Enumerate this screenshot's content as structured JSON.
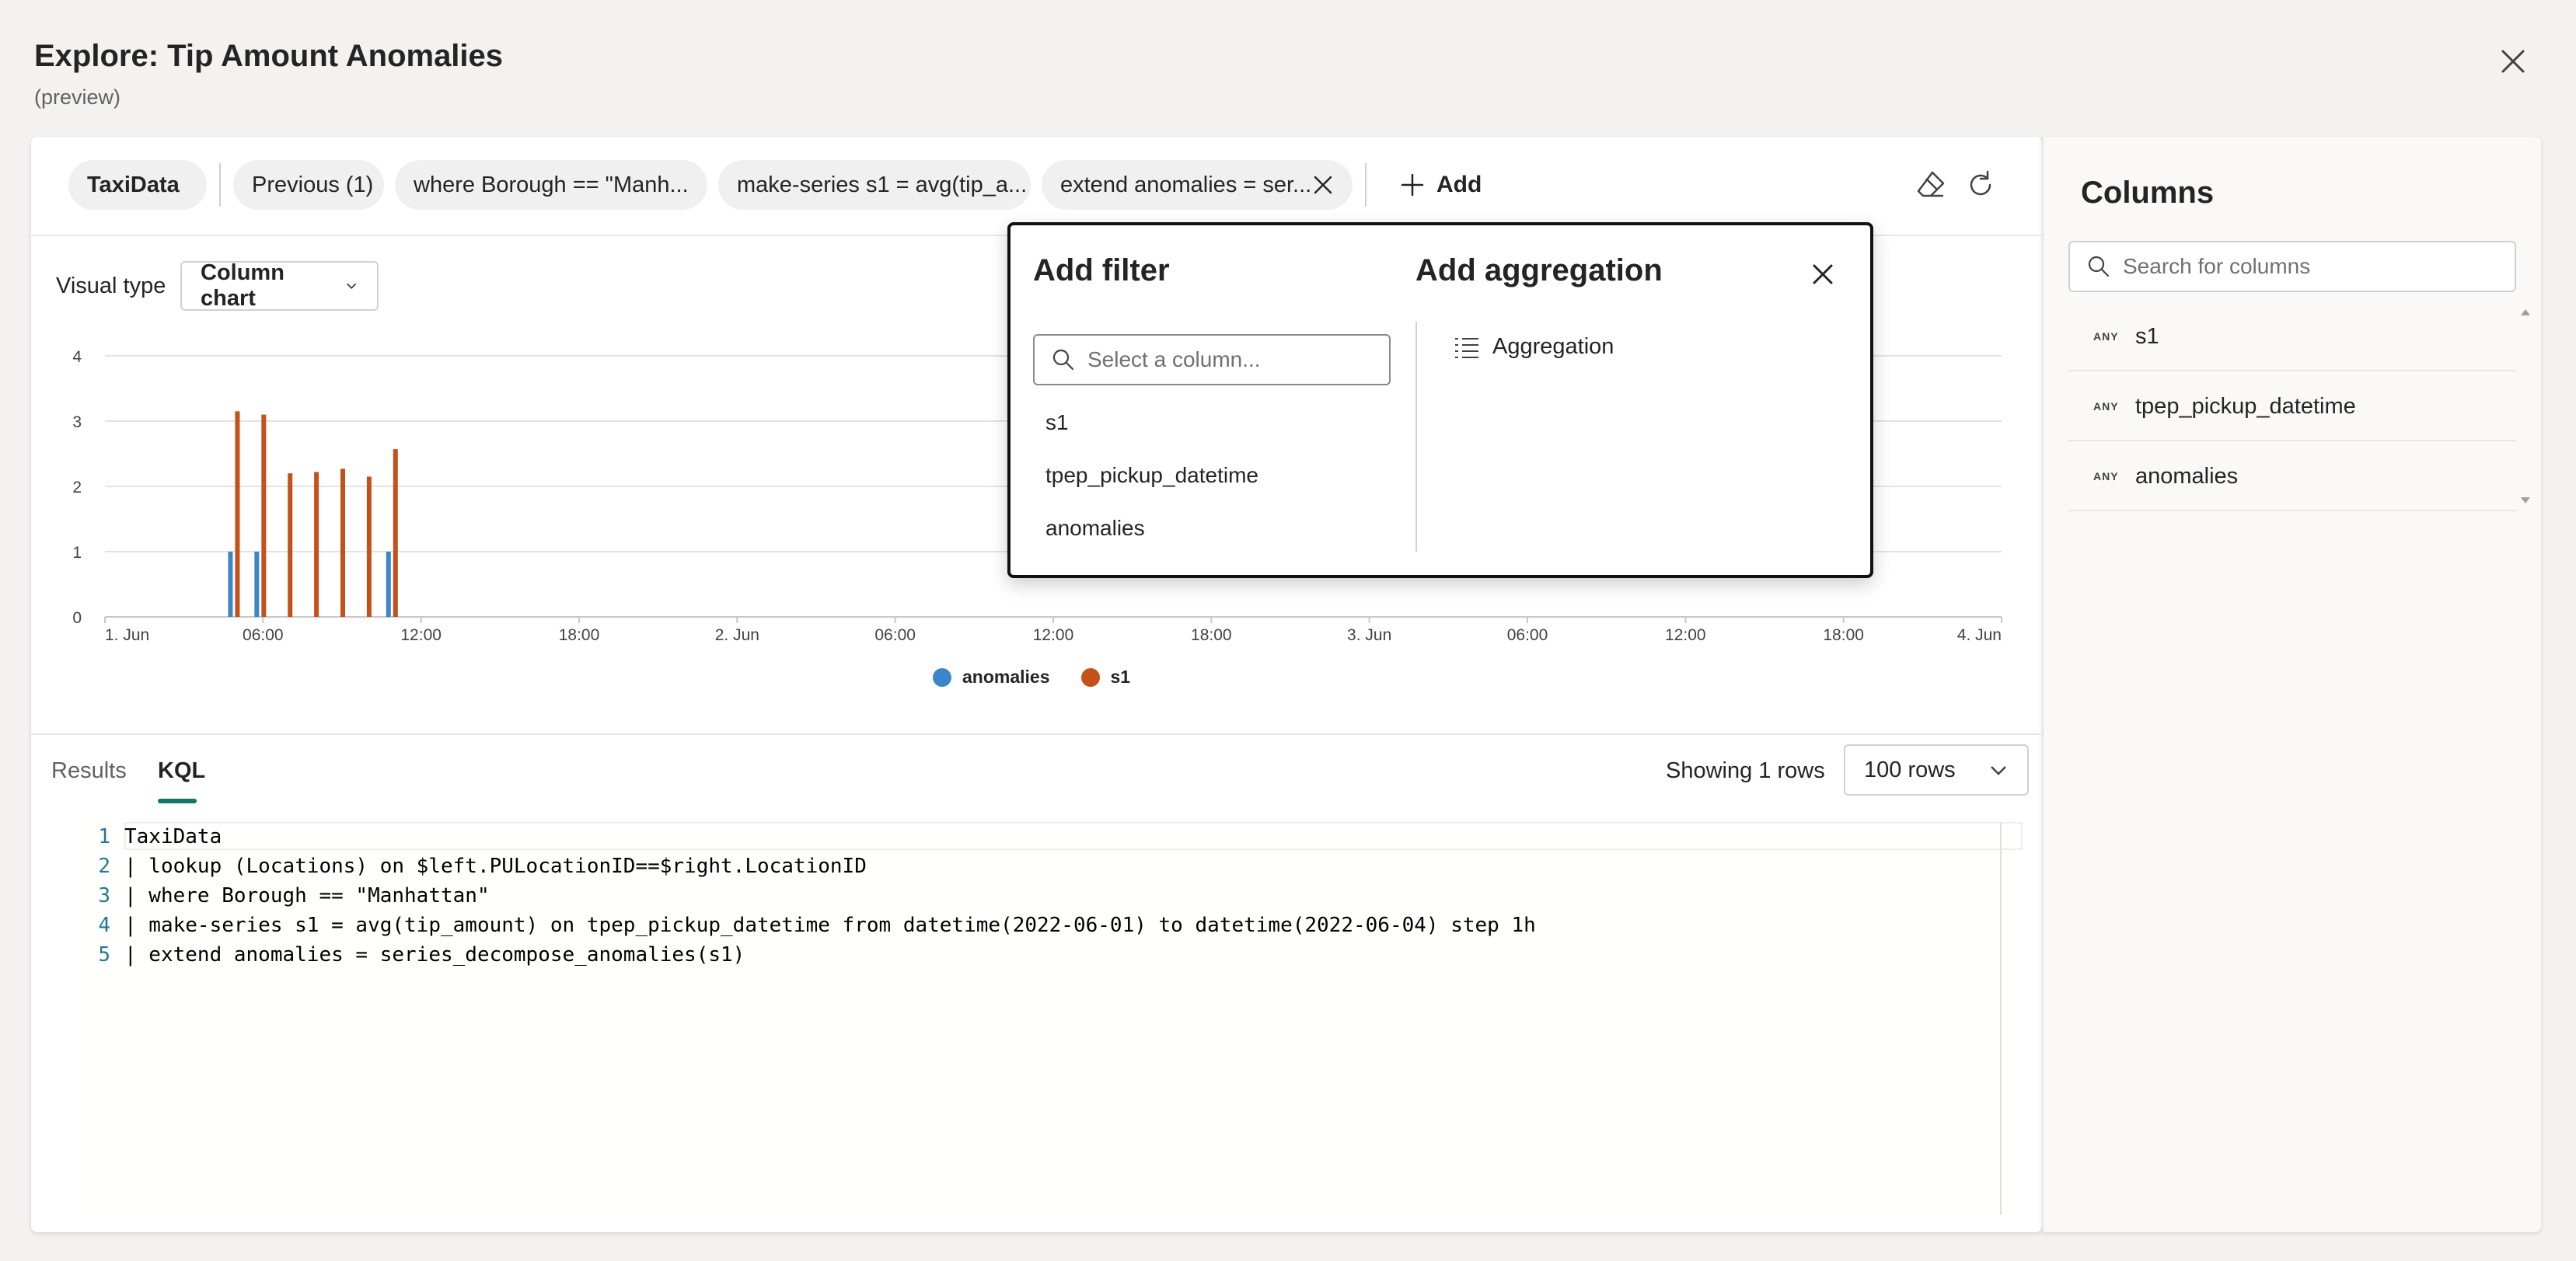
{
  "header": {
    "title": "Explore: Tip Amount Anomalies",
    "subtitle": "(preview)"
  },
  "pills": {
    "source": "TaxiData",
    "previous": "Previous (1)",
    "where": "where Borough == \"Manh...",
    "make_series": "make-series s1 = avg(tip_a...",
    "extend": "extend anomalies = ser...",
    "add_label": "Add"
  },
  "visual": {
    "type_label": "Visual type",
    "type_value": "Column chart"
  },
  "chart_data": {
    "type": "bar",
    "x_ticks": [
      "1. Jun",
      "06:00",
      "12:00",
      "18:00",
      "2. Jun",
      "06:00",
      "12:00",
      "18:00",
      "3. Jun",
      "06:00",
      "12:00",
      "18:00",
      "4. Jun"
    ],
    "y_ticks": [
      "0",
      "1",
      "2",
      "3",
      "4"
    ],
    "ylim": [
      0,
      4
    ],
    "x_unit": "hours since 2022-06-01 00:00 (0-72)",
    "series": [
      {
        "name": "anomalies",
        "color": "#3a86c8",
        "points": [
          [
            5,
            1
          ],
          [
            6,
            1
          ],
          [
            11,
            1
          ]
        ]
      },
      {
        "name": "s1",
        "color": "#c4501a",
        "points": [
          [
            5,
            3.15
          ],
          [
            6,
            3.1
          ],
          [
            7,
            2.2
          ],
          [
            8,
            2.22
          ],
          [
            9,
            2.27
          ],
          [
            10,
            2.15
          ],
          [
            11,
            2.57
          ]
        ]
      }
    ],
    "grid": true,
    "legend": "bottom-center"
  },
  "bottom": {
    "tab_results": "Results",
    "tab_kql": "KQL",
    "showing": "Showing 1 rows",
    "rows_value": "100 rows"
  },
  "editor": {
    "lines": [
      {
        "num": "1",
        "text": "TaxiData"
      },
      {
        "num": "2",
        "text": "| lookup (Locations) on $left.PULocationID==$right.LocationID"
      },
      {
        "num": "3",
        "text": "| where Borough == \"Manhattan\""
      },
      {
        "num": "4",
        "text": "| make-series s1 = avg(tip_amount) on tpep_pickup_datetime from datetime(2022-06-01) to datetime(2022-06-04) step 1h"
      },
      {
        "num": "5",
        "text": "| extend anomalies = series_decompose_anomalies(s1)"
      }
    ]
  },
  "columns_panel": {
    "title": "Columns",
    "search_placeholder": "Search for columns",
    "type_tag": "ANY",
    "items": [
      "s1",
      "tpep_pickup_datetime",
      "anomalies"
    ]
  },
  "popup": {
    "filter_title": "Add filter",
    "filter_placeholder": "Select a column...",
    "filter_options": [
      "s1",
      "tpep_pickup_datetime",
      "anomalies"
    ],
    "agg_title": "Add aggregation",
    "agg_item": "Aggregation"
  }
}
